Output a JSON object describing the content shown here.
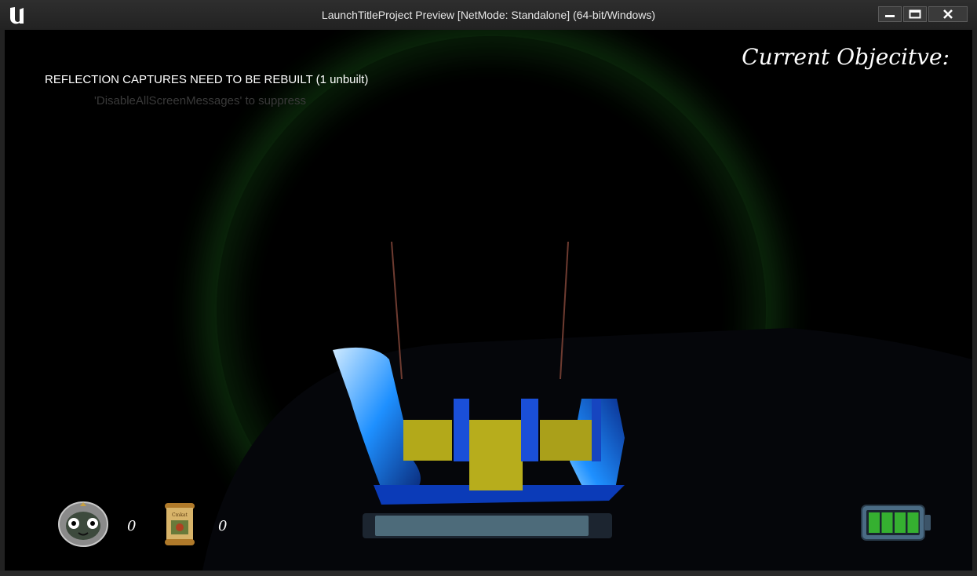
{
  "window": {
    "title": "LaunchTitleProject Preview [NetMode: Standalone]  (64-bit/Windows)",
    "app_icon": "unreal-engine-logo",
    "buttons": [
      "minimize",
      "maximize",
      "close"
    ]
  },
  "messages": {
    "warning": "REFLECTION CAPTURES NEED TO BE REBUILT (1 unbuilt)",
    "faded_hint": "'DisableAllScreenMessages' to suppress"
  },
  "hud": {
    "objective_title": "Current Objecitve:",
    "token_count": "0",
    "scroll_count": "0",
    "scroll_label": "Cmkat",
    "stamina_level": 0.95,
    "battery_cells": 4,
    "colors": {
      "battery_fill": "#35b030",
      "stamina_fill": "#4d6b7a",
      "glow": "#2f8c2f"
    }
  }
}
